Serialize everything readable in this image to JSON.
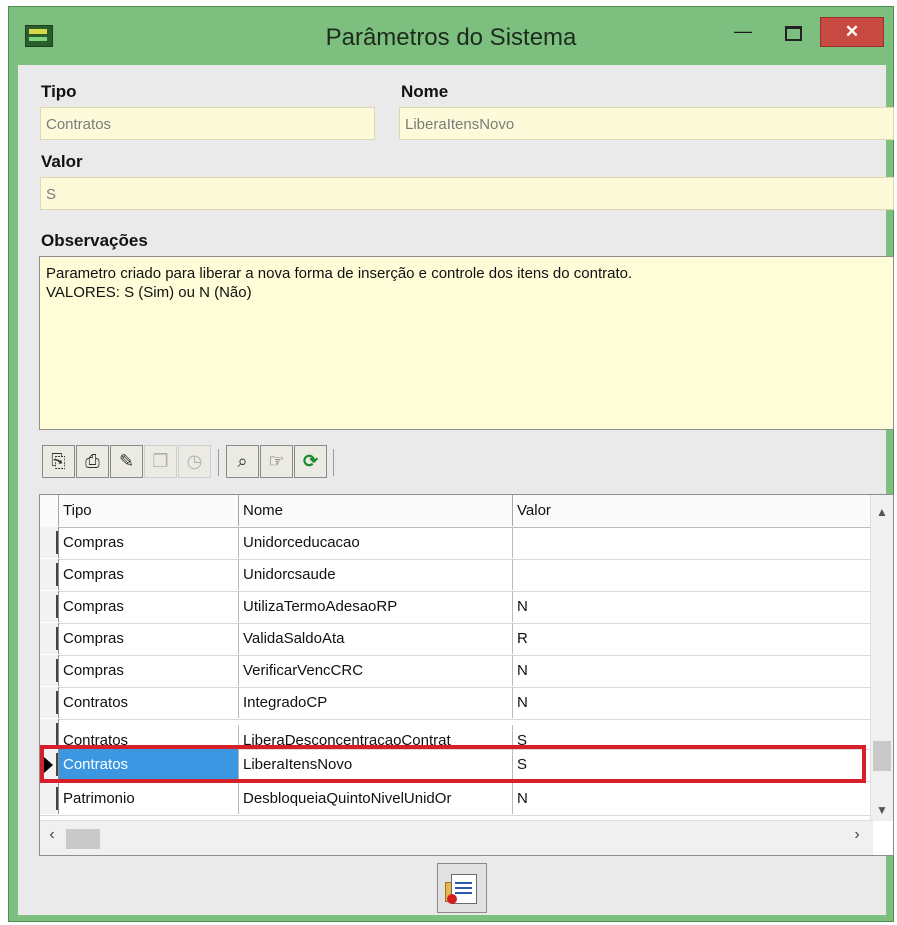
{
  "window": {
    "title": "Parâmetros do Sistema",
    "minimize_glyph": "—",
    "close_glyph": "✕"
  },
  "form": {
    "tipo_label": "Tipo",
    "tipo_value": "Contratos",
    "nome_label": "Nome",
    "nome_value": "LiberaItensNovo",
    "valor_label": "Valor",
    "valor_value": "S",
    "obs_label": "Observações",
    "obs_line1": "Parametro criado para liberar a nova forma de inserção e controle dos itens do contrato.",
    "obs_line2": "VALORES: S (Sim) ou N (Não)"
  },
  "toolbar": {
    "icons": [
      "import-icon",
      "print-icon",
      "edit-icon",
      "copy-icon",
      "clock-icon",
      "zoom-icon",
      "hand-pointer-icon",
      "refresh-icon"
    ]
  },
  "grid": {
    "columns": [
      "Tipo",
      "Nome",
      "Valor"
    ],
    "rows": [
      {
        "tipo": "Compras",
        "nome": "Unidorceducacao",
        "valor": ""
      },
      {
        "tipo": "Compras",
        "nome": "Unidorcsaude",
        "valor": ""
      },
      {
        "tipo": "Compras",
        "nome": "UtilizaTermoAdesaoRP",
        "valor": "N"
      },
      {
        "tipo": "Compras",
        "nome": "ValidaSaldoAta",
        "valor": "R"
      },
      {
        "tipo": "Compras",
        "nome": "VerificarVencCRC",
        "valor": "N"
      },
      {
        "tipo": "Contratos",
        "nome": "IntegradoCP",
        "valor": "N"
      },
      {
        "tipo": "Contratos",
        "nome": "LiberaDesconcentracaoContrat",
        "valor": "S"
      },
      {
        "tipo": "Contratos",
        "nome": "LiberaItensNovo",
        "valor": "S"
      },
      {
        "tipo": "Patrimonio",
        "nome": "DesbloqueiaQuintoNivelUnidOr",
        "valor": "N"
      }
    ],
    "selected_row": 7
  },
  "colors": {
    "window_bg": "#7dbf7f",
    "field_bg": "#fdfad9",
    "selected": "#3c97e3",
    "highlight": "#d71f2a"
  }
}
